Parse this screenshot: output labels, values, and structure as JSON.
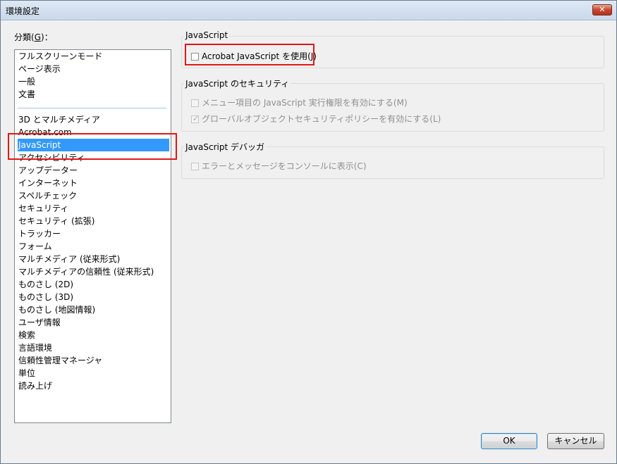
{
  "window": {
    "title": "環境設定",
    "close_symbol": "✕"
  },
  "category": {
    "label": "分類",
    "mnemonic": "G",
    "suffix": ")：",
    "prefix": "("
  },
  "list": {
    "items_top": [
      "フルスクリーンモード",
      "ページ表示",
      "一般",
      "文書"
    ],
    "items_bottom": [
      "3D とマルチメディア",
      "Acrobat.com",
      "JavaScript",
      "アクセシビリティ",
      "アップデーター",
      "インターネット",
      "スペルチェック",
      "セキュリティ",
      "セキュリティ (拡張)",
      "トラッカー",
      "フォーム",
      "マルチメディア (従来形式)",
      "マルチメディアの信頼性 (従来形式)",
      "ものさし (2D)",
      "ものさし (3D)",
      "ものさし (地図情報)",
      "ユーザ情報",
      "検索",
      "言語環境",
      "信頼性管理マネージャ",
      "単位",
      "読み上げ"
    ],
    "selected": "JavaScript"
  },
  "javascript_group": {
    "title": "JavaScript",
    "enable_label": "Acrobat JavaScript を使用(",
    "enable_mnemonic": "J",
    "enable_suffix": ")",
    "enable_checked": false
  },
  "security_group": {
    "title": "JavaScript のセキュリティ",
    "option1": "メニュー項目の JavaScript 実行権限を有効にする(M)",
    "option1_checked": false,
    "option2": "グローバルオブジェクトセキュリティポリシーを有効にする(L)",
    "option2_checked": true
  },
  "debugger_group": {
    "title": "JavaScript デバッガ",
    "option1": "エラーとメッセージをコンソールに表示(C)",
    "option1_checked": false
  },
  "buttons": {
    "ok": "OK",
    "cancel": "キャンセル"
  },
  "colors": {
    "selection": "#3399ff",
    "highlight_box": "#e01818"
  }
}
